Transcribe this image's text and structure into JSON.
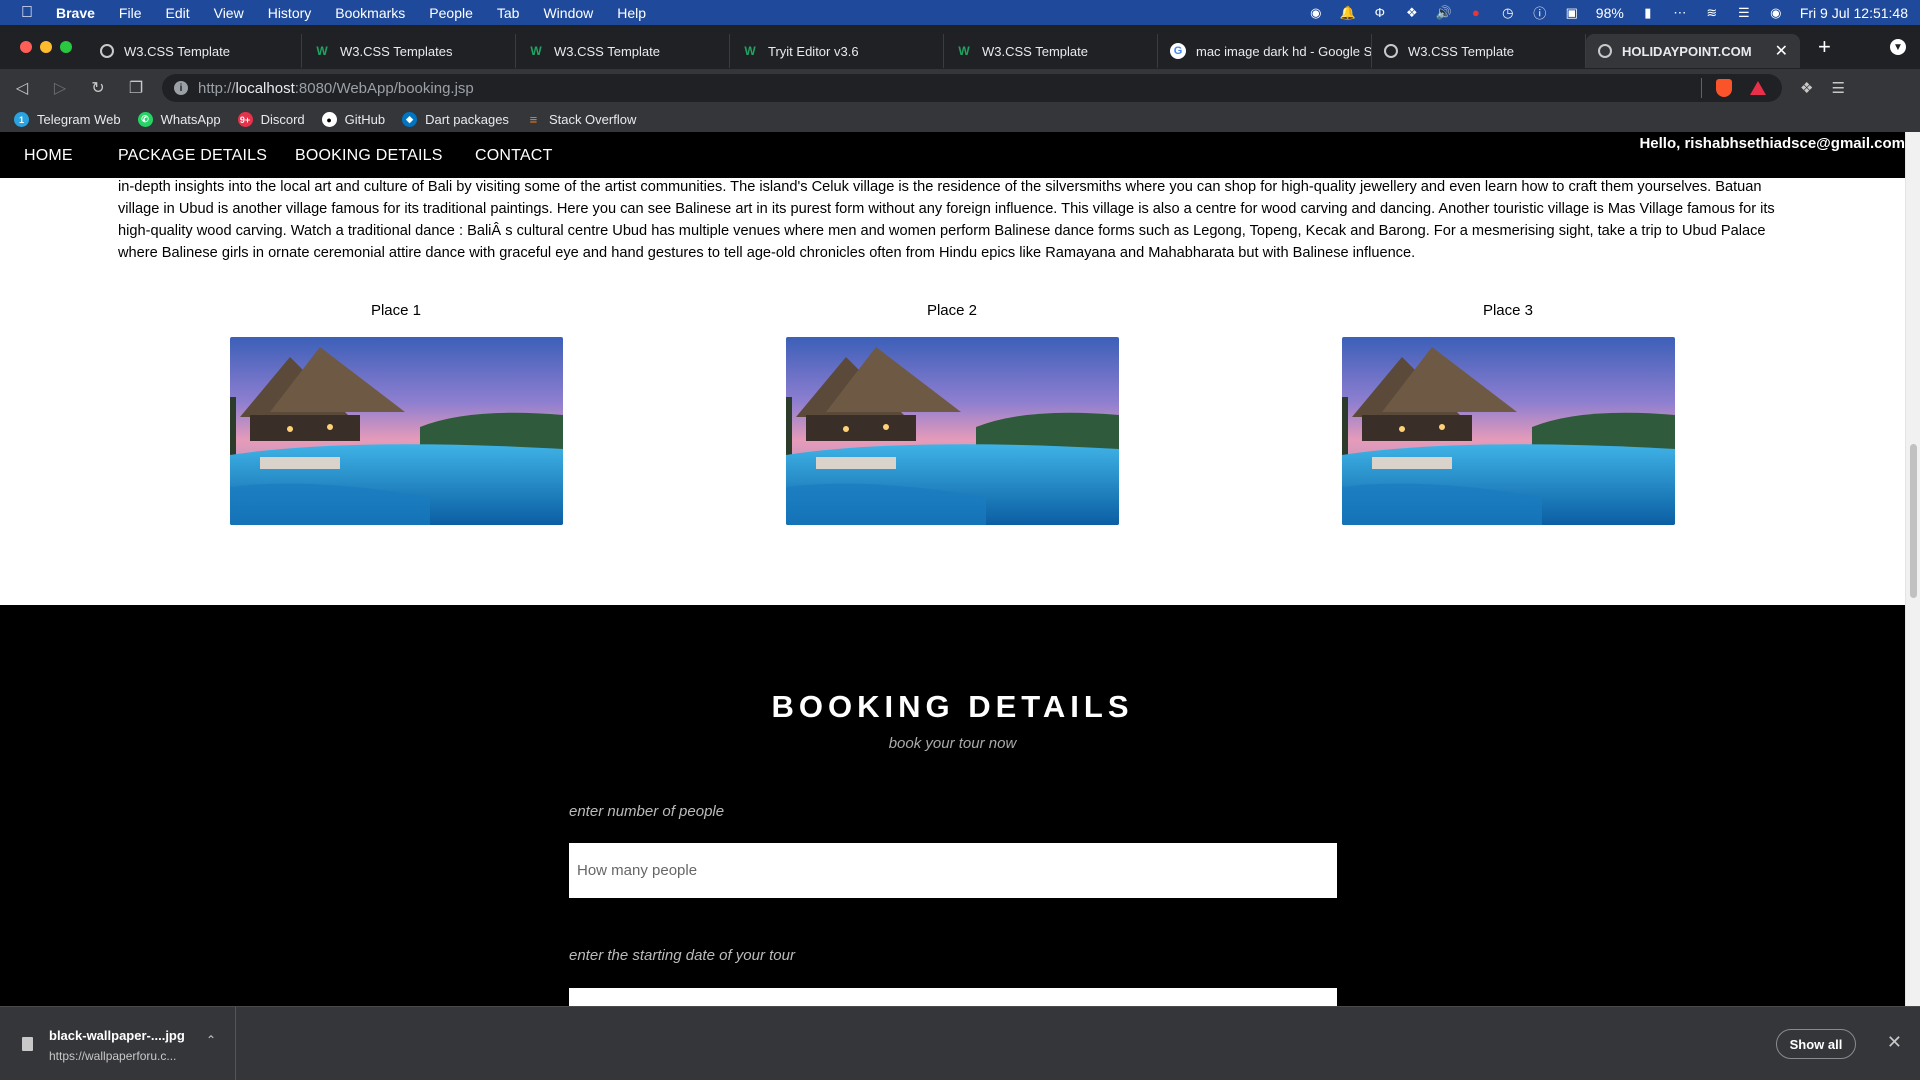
{
  "menubar": {
    "app": "Brave",
    "items": [
      "File",
      "Edit",
      "View",
      "History",
      "Bookmarks",
      "People",
      "Tab",
      "Window",
      "Help"
    ],
    "battery": "98%",
    "clock": "Fri 9 Jul  12:51:48"
  },
  "tabs": [
    {
      "title": "W3.CSS Template",
      "icon": "globe-icon"
    },
    {
      "title": "W3.CSS Templates",
      "icon": "w3schools-icon"
    },
    {
      "title": "W3.CSS Template",
      "icon": "w3schools-icon"
    },
    {
      "title": "Tryit Editor v3.6",
      "icon": "w3schools-icon"
    },
    {
      "title": "W3.CSS Template",
      "icon": "w3schools-icon"
    },
    {
      "title": "mac image dark hd - Google Se",
      "icon": "google-icon"
    },
    {
      "title": "W3.CSS Template",
      "icon": "globe-icon"
    },
    {
      "title": "HOLIDAYPOINT.COM",
      "icon": "globe-icon",
      "active": true
    }
  ],
  "address": {
    "scheme": "http://",
    "host": "localhost",
    "rest": ":8080/WebApp/booking.jsp"
  },
  "bookmarks": [
    {
      "label": "Telegram Web",
      "icon": "telegram-icon",
      "color": "#2aa3e0"
    },
    {
      "label": "WhatsApp",
      "icon": "whatsapp-icon",
      "color": "#25d366"
    },
    {
      "label": "Discord",
      "icon": "discord-icon",
      "color": "#e8324c"
    },
    {
      "label": "GitHub",
      "icon": "github-icon",
      "color": "#ffffff"
    },
    {
      "label": "Dart packages",
      "icon": "dart-icon",
      "color": "#0175c2"
    },
    {
      "label": "Stack Overflow",
      "icon": "stackoverflow-icon",
      "color": "#f48024"
    }
  ],
  "site": {
    "nav": [
      "HOME",
      "PACKAGE DETAILS",
      "BOOKING DETAILS",
      "CONTACT"
    ],
    "greeting": "Hello, rishabhsethiadsce@gmail.com",
    "description": "in-depth insights into the local art and culture of Bali by visiting some of the artist communities. The island's Celuk village is the residence of the silversmiths where you can shop for high-quality jewellery and even learn how to craft them yourselves. Batuan village in Ubud is another village famous for its traditional paintings. Here you can see Balinese art in its purest form without any foreign influence. This village is also a centre for wood carving and dancing. Another touristic village is Mas Village famous for its high-quality wood carving. Watch a traditional dance : BaliÂ    s cultural centre Ubud has multiple venues where men and women perform Balinese dance forms such as Legong, Topeng, Kecak and Barong. For a mesmerising sight, take a trip to Ubud Palace where Balinese girls in ornate ceremonial attire dance with graceful eye and hand gestures to tell age-old chronicles often from Hindu epics like Ramayana and Mahabharata but with Balinese influence.",
    "places": [
      "Place 1",
      "Place 2",
      "Place 3"
    ],
    "booking": {
      "title": "BOOKING DETAILS",
      "subtitle": "book your tour now",
      "people_label": "enter number of people",
      "people_placeholder": "How many people",
      "date_label": "enter the starting date of your tour"
    }
  },
  "download": {
    "filename": "black-wallpaper-....jpg",
    "url": "https://wallpaperforu.c...",
    "show_all": "Show all"
  }
}
